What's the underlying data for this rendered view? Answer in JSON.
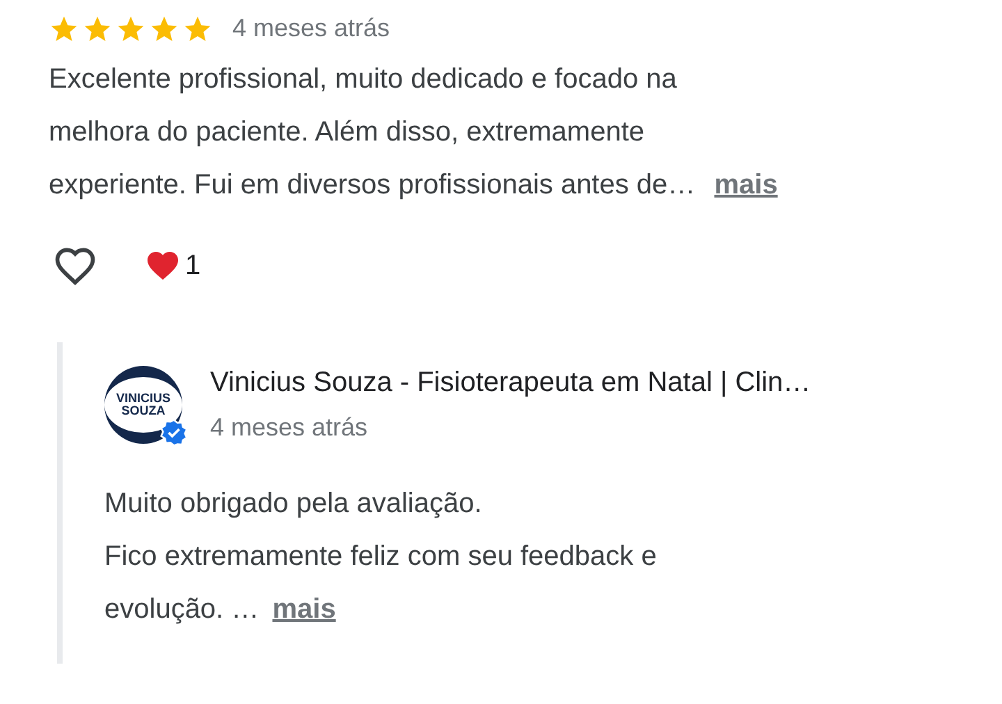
{
  "review": {
    "stars": 5,
    "time": "4 meses atrás",
    "text": "Excelente profissional, muito dedicado e focado na\nmelhora do paciente. Além disso, extremamente\nexperiente. Fui em diversos profissionais antes de…",
    "more": "mais",
    "liked": false,
    "reaction_count": "1"
  },
  "reply": {
    "avatar_text": [
      "VINICIUS",
      "SOUZA"
    ],
    "verified": true,
    "name": "Vinicius Souza - Fisioterapeuta em Natal | Clin…",
    "time": "4 meses atrás",
    "text": "Muito obrigado pela avaliação.\nFico extremamente feliz com seu feedback e\nevolução. …",
    "more": "mais"
  }
}
